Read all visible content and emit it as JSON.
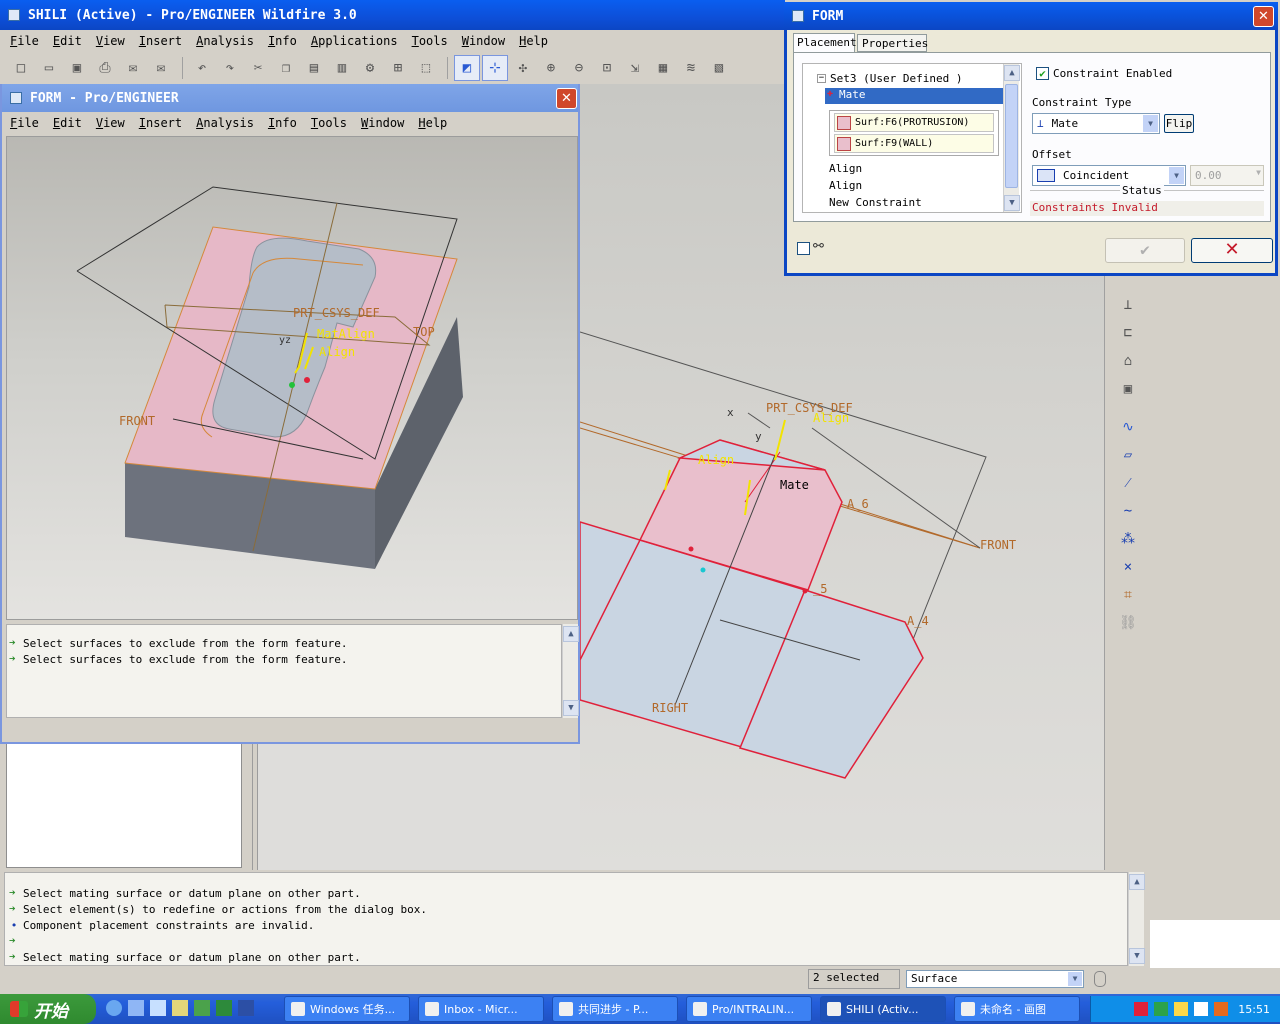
{
  "main_window": {
    "title": "SHILI (Active) - Pro/ENGINEER Wildfire 3.0",
    "menu": [
      "File",
      "Edit",
      "View",
      "Insert",
      "Analysis",
      "Info",
      "Applications",
      "Tools",
      "Window",
      "Help"
    ]
  },
  "form_window": {
    "title": "FORM - Pro/ENGINEER",
    "menu": [
      "File",
      "Edit",
      "View",
      "Insert",
      "Analysis",
      "Info",
      "Tools",
      "Window",
      "Help"
    ],
    "viewport_labels": {
      "csys": "PRT_CSYS_DEF",
      "mate_align": "MatAlign",
      "align": "Align",
      "top": "TOP",
      "front": "FRONT",
      "yz": "yz"
    },
    "messages": [
      "Select surfaces to exclude from the form feature.",
      "Select surfaces to exclude from the form feature."
    ]
  },
  "main_viewport_labels": {
    "csys": "PRT_CSYS_DEF",
    "align_top": "Align",
    "align_mid": "Align",
    "mate": "Mate",
    "a6": "A_6",
    "a5": "_5",
    "a4": "A_4",
    "front": "FRONT",
    "right": "RIGHT",
    "x": "x",
    "y": "y"
  },
  "dialog": {
    "title": "FORM",
    "tabs": [
      "Placement",
      "Properties"
    ],
    "tree": {
      "set": "Set3 (User Defined )",
      "selected": "Mate",
      "refs": [
        "Surf:F6(PROTRUSION)",
        "Surf:F9(WALL)"
      ],
      "others": [
        "Align",
        "Align",
        "New Constraint"
      ]
    },
    "constraint_enabled_label": "Constraint Enabled",
    "constraint_type_label": "Constraint Type",
    "constraint_type_value": "Mate",
    "flip_label": "Flip",
    "offset_label": "Offset",
    "offset_value": "Coincident",
    "offset_number": "0.00",
    "status_label": "Status",
    "status_text": "Constraints Invalid",
    "ok_icon": "check-icon",
    "cancel_icon": "x-icon"
  },
  "bottom_messages": [
    {
      "type": "arrow",
      "text": "Select mating surface or datum plane on other part."
    },
    {
      "type": "arrow",
      "text": "Select element(s) to redefine or actions from the dialog box."
    },
    {
      "type": "dot",
      "text": "Component placement constraints are invalid."
    },
    {
      "type": "arrow",
      "text": ""
    },
    {
      "type": "arrow",
      "text": "Select mating surface or datum plane on other part."
    }
  ],
  "status_bar": {
    "selected": "2 selected",
    "filter": "Surface"
  },
  "taskbar": {
    "start": "开始",
    "tasks": [
      "Windows 任务...",
      "Inbox - Micr...",
      "共同进步 - P...",
      "Pro/INTRALIN...",
      "SHILI (Activ...",
      "未命名 - 画图"
    ],
    "clock": "15:51"
  },
  "colors": {
    "accent_red": "#e0213a",
    "datum_orange": "#b2692a",
    "title_blue": "#2a5ad3"
  }
}
